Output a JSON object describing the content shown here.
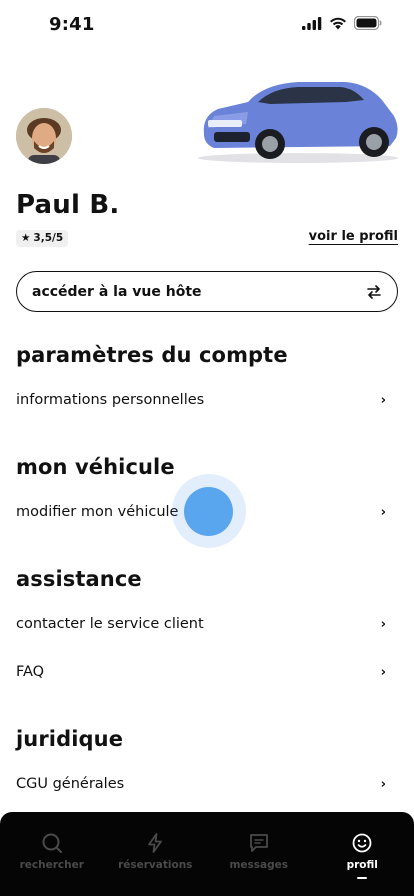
{
  "status_bar": {
    "time": "9:41"
  },
  "profile": {
    "name": "Paul B.",
    "rating": "3,5/5",
    "rating_star": "★",
    "view_profile_label": "voir le profil"
  },
  "host_view_button": {
    "label": "accéder à la vue hôte",
    "icon": "swap-icon"
  },
  "sections": {
    "account": {
      "title": "paramètres du compte",
      "items": [
        "informations personnelles"
      ]
    },
    "vehicle": {
      "title": "mon véhicule",
      "items": [
        "modifier mon véhicule"
      ]
    },
    "assistance": {
      "title": "assistance",
      "items": [
        "contacter le service client",
        "FAQ"
      ]
    },
    "legal": {
      "title": "juridique",
      "items": [
        "CGU générales"
      ]
    }
  },
  "bottom_nav": {
    "items": [
      {
        "label": "rechercher",
        "icon": "search-icon"
      },
      {
        "label": "réservations",
        "icon": "bolt-icon"
      },
      {
        "label": "messages",
        "icon": "message-icon"
      },
      {
        "label": "profil",
        "icon": "smiley-icon",
        "active": true
      }
    ]
  },
  "colors": {
    "accent_touch": "#5aa6ee",
    "car": "#6a82d8",
    "nav_bg": "#050505"
  }
}
